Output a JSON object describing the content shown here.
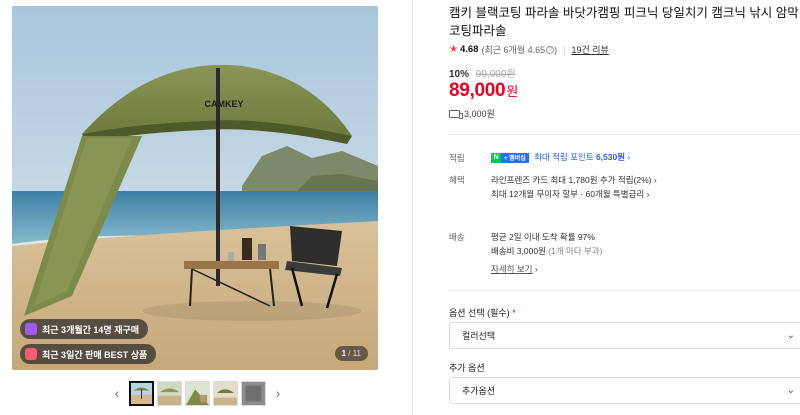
{
  "gallery": {
    "hero_alt": "CAMKEY 블랙코팅 파라솔 해변 이미지",
    "hero_brand": "CAMKEY",
    "badges": [
      {
        "icon": "bag-icon",
        "text": "최근 3개월간 14명 재구매"
      },
      {
        "icon": "gift-icon",
        "text": "최근 3일간 판매 BEST 상품"
      }
    ],
    "counter_current": "1",
    "counter_total": "/ 11",
    "prev_label": "‹",
    "next_label": "›",
    "thumb_count": 5
  },
  "product": {
    "title": "캠키 블랙코팅 파라솔 바닷가캠핑 피크닉 당일치기 캠크닉 낚시 암막코팅파라솔",
    "rating_score": "4.68",
    "rating_recent": "(최근 6개월 4.65",
    "rating_recent_close": ")",
    "review_link": "19건 리뷰",
    "discount_rate": "10%",
    "original_price": "99,000원",
    "price": "89,000",
    "currency": "원",
    "shipping_fee": "3,000원"
  },
  "benefits": {
    "points_label": "적립",
    "points_text": "최대 적립 포인트",
    "points_value": "6,530원",
    "points_arrow": "›",
    "npay_badge_n": "N",
    "npay_badge_plus": "+ 멤버십",
    "perks_label": "혜택",
    "perks_line1": "라인프렌즈 카드 최대 1,780원 추가 적립(2%)",
    "perks_line1_arrow": "›",
    "perks_line2": "최대 12개월 무이자 할부 · 60개월 특별금리",
    "perks_line2_arrow": "›"
  },
  "delivery": {
    "label": "배송",
    "arrival": "평균 2일 이내 도착 확률 97%",
    "fee_prefix": "배송비 3,000원",
    "fee_suffix": "(1개 마다 부과)",
    "detail_link": "자세히 보기",
    "detail_arrow": "›"
  },
  "options": {
    "required_label": "옵션 선택 (필수)",
    "required_mark": "*",
    "color_select": "컬러선택",
    "extra_label": "추가 옵션",
    "extra_select": "추가옵션",
    "chevron": "⌄"
  },
  "colors": {
    "price_red": "#e0002a",
    "link_blue": "#2c5fd8",
    "npay_green": "#03c75a",
    "umbrella_green": "#7d8a4a"
  }
}
